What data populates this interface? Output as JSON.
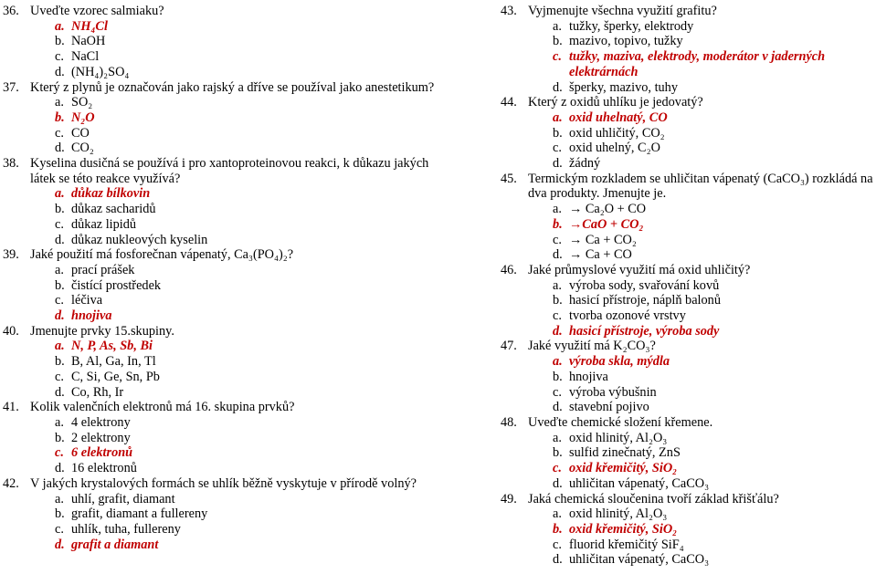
{
  "document": {
    "language": "cs",
    "accent_color": "#C00000",
    "text_color": "#000000"
  },
  "left_column": [
    {
      "number": "36.",
      "text": "Uveďte vzorec salmiaku?",
      "answers": [
        {
          "letter": "a.",
          "text": "NH₄Cl",
          "correct": true
        },
        {
          "letter": "b.",
          "text": "NaOH",
          "correct": false
        },
        {
          "letter": "c.",
          "text": "NaCl",
          "correct": false
        },
        {
          "letter": "d.",
          "text": "(NH₄)₂SO₄",
          "correct": false
        }
      ]
    },
    {
      "number": "37.",
      "text": "Který z plynů je označován jako rajský a  dříve se používal jako anestetikum?",
      "answers": [
        {
          "letter": "a.",
          "text": "SO₂",
          "correct": false
        },
        {
          "letter": "b.",
          "text": "N₂O",
          "correct": true
        },
        {
          "letter": "c.",
          "text": "CO",
          "correct": false
        },
        {
          "letter": "d.",
          "text": "CO₂",
          "correct": false
        }
      ]
    },
    {
      "number": "38.",
      "text": "Kyselina dusičná se používá i pro xantoproteinovou reakci, k důkazu jakých látek se této reakce využívá?",
      "answers": [
        {
          "letter": "a.",
          "text": "důkaz bílkovin",
          "correct": true
        },
        {
          "letter": "b.",
          "text": "důkaz sacharidů",
          "correct": false
        },
        {
          "letter": "c.",
          "text": "důkaz lipidů",
          "correct": false
        },
        {
          "letter": "d.",
          "text": "důkaz nukleových kyselin",
          "correct": false
        }
      ]
    },
    {
      "number": "39.",
      "text": "Jaké použití má fosforečnan vápenatý, Ca₃(PO₄)₂?",
      "answers": [
        {
          "letter": "a.",
          "text": "prací prášek",
          "correct": false
        },
        {
          "letter": "b.",
          "text": "čistící prostředek",
          "correct": false
        },
        {
          "letter": "c.",
          "text": "léčiva",
          "correct": false
        },
        {
          "letter": "d.",
          "text": "hnojiva",
          "correct": true
        }
      ]
    },
    {
      "number": "40.",
      "text": "Jmenujte prvky 15.skupiny.",
      "answers": [
        {
          "letter": "a.",
          "text": "N, P, As, Sb, Bi",
          "correct": true
        },
        {
          "letter": "b.",
          "text": "B, Al, Ga, In, Tl",
          "correct": false
        },
        {
          "letter": "c.",
          "text": "C, Si, Ge, Sn, Pb",
          "correct": false
        },
        {
          "letter": "d.",
          "text": "Co, Rh, Ir",
          "correct": false
        }
      ]
    },
    {
      "number": "41.",
      "text": "Kolik valenčních elektronů má 16. skupina prvků?",
      "answers": [
        {
          "letter": "a.",
          "text": "4 elektrony",
          "correct": false
        },
        {
          "letter": "b.",
          "text": "2 elektrony",
          "correct": false
        },
        {
          "letter": "c.",
          "text": "6 elektronů",
          "correct": true
        },
        {
          "letter": "d.",
          "text": "16 elektronů",
          "correct": false
        }
      ]
    },
    {
      "number": "42.",
      "text": "V jakých krystalových formách se uhlík běžně vyskytuje v přírodě volný?",
      "answers": [
        {
          "letter": "a.",
          "text": "uhlí, grafit, diamant",
          "correct": false
        },
        {
          "letter": "b.",
          "text": "grafit, diamant a fullereny",
          "correct": false
        },
        {
          "letter": "c.",
          "text": "uhlík, tuha, fullereny",
          "correct": false
        },
        {
          "letter": "d.",
          "text": "grafit a diamant",
          "correct": true
        }
      ]
    }
  ],
  "right_column": [
    {
      "number": "43.",
      "text": "Vyjmenujte všechna využití grafitu?",
      "answers": [
        {
          "letter": "a.",
          "text": "tužky, šperky, elektrody",
          "correct": false
        },
        {
          "letter": "b.",
          "text": "mazivo, topivo, tužky",
          "correct": false
        },
        {
          "letter": "c.",
          "text": "tužky, maziva, elektrody, moderátor v jaderných elektrárnách",
          "correct": true
        },
        {
          "letter": "d.",
          "text": "šperky, mazivo, tuhy",
          "correct": false
        }
      ]
    },
    {
      "number": "44.",
      "text": "Který z oxidů uhlíku je jedovatý?",
      "answers": [
        {
          "letter": "a.",
          "text": "oxid uhelnatý, CO",
          "correct": true
        },
        {
          "letter": "b.",
          "text": "oxid uhličitý, CO₂",
          "correct": false
        },
        {
          "letter": "c.",
          "text": "oxid uhelný, C₂O",
          "correct": false
        },
        {
          "letter": "d.",
          "text": "žádný",
          "correct": false
        }
      ]
    },
    {
      "number": "45.",
      "text": "Termickým rozkladem se uhličitan vápenatý (CaCO₃) rozkládá na dva produkty. Jmenujte je.",
      "answers": [
        {
          "letter": "a.",
          "text": "→ Ca₂O + CO",
          "correct": false
        },
        {
          "letter": "b.",
          "text": "→CaO + CO₂",
          "correct": true
        },
        {
          "letter": "c.",
          "text": "→ Ca + CO₂",
          "correct": false
        },
        {
          "letter": "d.",
          "text": "→ Ca + CO",
          "correct": false
        }
      ]
    },
    {
      "number": "46.",
      "text": "Jaké průmyslové využití má oxid uhličitý?",
      "answers": [
        {
          "letter": "a.",
          "text": "výroba sody, svařování kovů",
          "correct": false
        },
        {
          "letter": "b.",
          "text": "hasicí přístroje, náplň balonů",
          "correct": false
        },
        {
          "letter": "c.",
          "text": "tvorba ozonové vrstvy",
          "correct": false
        },
        {
          "letter": "d.",
          "text": "hasicí přístroje, výroba sody",
          "correct": true
        }
      ]
    },
    {
      "number": "47.",
      "text": "Jaké využití má K₂CO₃?",
      "answers": [
        {
          "letter": "a.",
          "text": "výroba skla, mýdla",
          "correct": true
        },
        {
          "letter": "b.",
          "text": "hnojiva",
          "correct": false
        },
        {
          "letter": "c.",
          "text": "výroba výbušnin",
          "correct": false
        },
        {
          "letter": "d.",
          "text": "stavební pojivo",
          "correct": false
        }
      ]
    },
    {
      "number": "48.",
      "text": "Uveďte chemické složení křemene.",
      "answers": [
        {
          "letter": "a.",
          "text": "oxid hlinitý, Al₂O₃",
          "correct": false
        },
        {
          "letter": "b.",
          "text": "sulfid zinečnatý, ZnS",
          "correct": false
        },
        {
          "letter": "c.",
          "text": "oxid křemičitý, SiO₂",
          "correct": true
        },
        {
          "letter": "d.",
          "text": "uhličitan vápenatý, CaCO₃",
          "correct": false
        }
      ]
    },
    {
      "number": "49.",
      "text": "Jaká chemická sloučenina tvoří základ křišťálu?",
      "answers": [
        {
          "letter": "a.",
          "text": "oxid hlinitý, Al₂O₃",
          "correct": false
        },
        {
          "letter": "b.",
          "text": "oxid křemičitý, SiO₂",
          "correct": true
        },
        {
          "letter": "c.",
          "text": "fluorid křemičitý SiF₄",
          "correct": false
        },
        {
          "letter": "d.",
          "text": "uhličitan vápenatý, CaCO₃",
          "correct": false
        }
      ]
    }
  ]
}
